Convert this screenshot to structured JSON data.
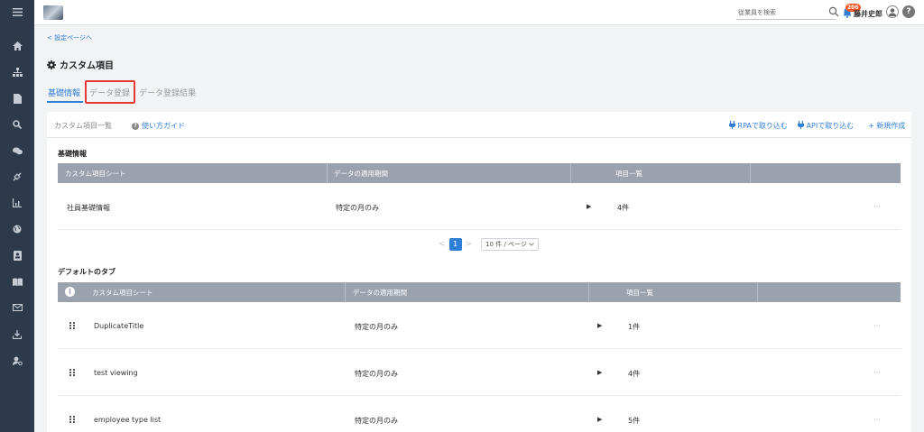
{
  "topbar": {
    "search_placeholder": "従業員を検索",
    "notification_count": "206",
    "user_name": "藤井史郎",
    "help_label": "?"
  },
  "back_link": "< 設定ページへ",
  "page_title": "カスタム項目",
  "tabs": [
    {
      "label": "基礎情報",
      "active": true
    },
    {
      "label": "データ登録",
      "active": false
    },
    {
      "label": "データ登録結果",
      "active": false
    }
  ],
  "card": {
    "subtitle": "カスタム項目一覧",
    "guide_label": "使い方ガイド",
    "actions": {
      "rpa": "RPAで取り込む",
      "api": "APIで取り込む",
      "new": "+ 新規作成"
    }
  },
  "basic_section": {
    "title": "基礎情報",
    "headers": [
      "カスタム項目シート",
      "データの適用期間",
      "項目一覧"
    ],
    "rows": [
      {
        "sheet": "社員基礎情報",
        "period": "特定の月のみ",
        "count": "4件"
      }
    ]
  },
  "pagination": {
    "current_page": "1",
    "page_size": "10 件 / ページ"
  },
  "default_section": {
    "title": "デフォルトのタブ",
    "headers": [
      "カスタム項目シート",
      "データの適用期間",
      "項目一覧"
    ],
    "rows": [
      {
        "sheet": "DuplicateTitle",
        "period": "特定の月のみ",
        "count": "1件"
      },
      {
        "sheet": "test viewing",
        "period": "特定の月のみ",
        "count": "4件"
      },
      {
        "sheet": "employee type list",
        "period": "特定の月のみ",
        "count": "5件"
      }
    ]
  },
  "glyphs": {
    "arrow": "▶",
    "more": "···",
    "prev": "<",
    "next": ">",
    "info": "i"
  },
  "colors": {
    "accent": "#2f7fd8",
    "sidebar": "#2d3a4b",
    "table_header": "#9aa2ae",
    "highlight": "#e53935",
    "badge": "#f05a28"
  }
}
